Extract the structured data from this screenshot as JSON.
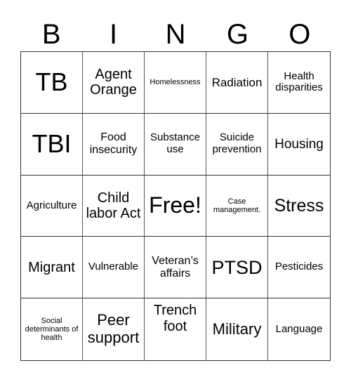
{
  "header": [
    "B",
    "I",
    "N",
    "G",
    "O"
  ],
  "cells": [
    "TB",
    "Agent Orange",
    "Homelessness",
    "Radiation",
    "Health disparities",
    "TBI",
    "Food insecurity",
    "Substance use",
    "Suicide prevention",
    "Housing",
    "Agriculture",
    "Child labor Act",
    "Free!",
    "Case management.",
    "Stress",
    "Migrant",
    "Vulnerable",
    "Veteran’s affairs",
    "PTSD",
    "Pesticides",
    "Social determinants of health",
    "Peer support",
    "Trench foot",
    "Military",
    "Language"
  ]
}
